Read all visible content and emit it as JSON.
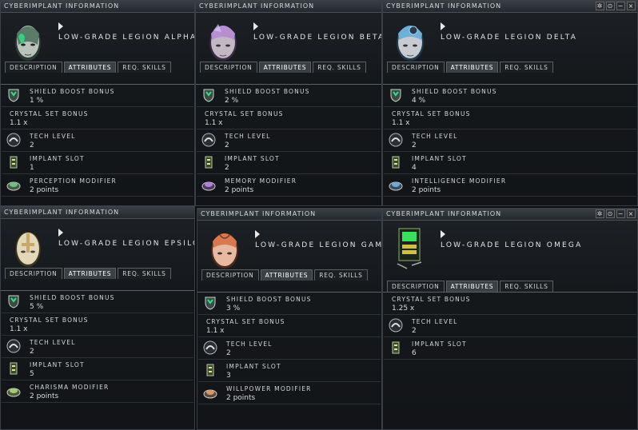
{
  "windows": [
    {
      "title": "CYBERIMPLANT INFORMATION",
      "name": "LOW-GRADE LEGION ALPHA",
      "tabs": [
        "DESCRIPTION",
        "ATTRIBUTES",
        "REQ. SKILLS"
      ],
      "rows": [
        {
          "label": "SHIELD BOOST BONUS",
          "value": "1 %"
        },
        {
          "label": "CRYSTAL SET BONUS",
          "value": "1.1 x"
        },
        {
          "label": "TECH LEVEL",
          "value": "2"
        },
        {
          "label": "IMPLANT SLOT",
          "value": "1"
        },
        {
          "label": "PERCEPTION MODIFIER",
          "value": "2 points"
        }
      ]
    },
    {
      "title": "CYBERIMPLANT INFORMATION",
      "name": "LOW-GRADE LEGION BETA",
      "tabs": [
        "DESCRIPTION",
        "ATTRIBUTES",
        "REQ. SKILLS"
      ],
      "rows": [
        {
          "label": "SHIELD BOOST BONUS",
          "value": "2 %"
        },
        {
          "label": "CRYSTAL SET BONUS",
          "value": "1.1 x"
        },
        {
          "label": "TECH LEVEL",
          "value": "2"
        },
        {
          "label": "IMPLANT SLOT",
          "value": "2"
        },
        {
          "label": "MEMORY MODIFIER",
          "value": "2 points"
        }
      ]
    },
    {
      "title": "CYBERIMPLANT INFORMATION",
      "name": "LOW-GRADE LEGION DELTA",
      "tabs": [
        "DESCRIPTION",
        "ATTRIBUTES",
        "REQ. SKILLS"
      ],
      "buttons": [
        "✲",
        "⊙",
        "−",
        "×"
      ],
      "rows": [
        {
          "label": "SHIELD BOOST BONUS",
          "value": "4 %"
        },
        {
          "label": "CRYSTAL SET BONUS",
          "value": "1.1 x"
        },
        {
          "label": "TECH LEVEL",
          "value": "2"
        },
        {
          "label": "IMPLANT SLOT",
          "value": "4"
        },
        {
          "label": "INTELLIGENCE MODIFIER",
          "value": "2 points"
        }
      ]
    },
    {
      "title": "CYBERIMPLANT INFORMATION",
      "name": "LOW-GRADE LEGION EPSILO",
      "tabs": [
        "DESCRIPTION",
        "ATTRIBUTES",
        "REQ. SKILLS"
      ],
      "rows": [
        {
          "label": "SHIELD BOOST BONUS",
          "value": "5 %"
        },
        {
          "label": "CRYSTAL SET BONUS",
          "value": "1.1 x"
        },
        {
          "label": "TECH LEVEL",
          "value": "2"
        },
        {
          "label": "IMPLANT SLOT",
          "value": "5"
        },
        {
          "label": "CHARISMA MODIFIER",
          "value": "2 points"
        }
      ]
    },
    {
      "title": "CYBERIMPLANT INFORMATION",
      "name": "LOW-GRADE LEGION GAMM",
      "tabs": [
        "DESCRIPTION",
        "ATTRIBUTES",
        "REQ. SKILLS"
      ],
      "rows": [
        {
          "label": "SHIELD BOOST BONUS",
          "value": "3 %"
        },
        {
          "label": "CRYSTAL SET BONUS",
          "value": "1.1 x"
        },
        {
          "label": "TECH LEVEL",
          "value": "2"
        },
        {
          "label": "IMPLANT SLOT",
          "value": "3"
        },
        {
          "label": "WILLPOWER MODIFIER",
          "value": "2 points"
        }
      ]
    },
    {
      "title": "CYBERIMPLANT INFORMATION",
      "name": "LOW-GRADE LEGION OMEGA",
      "tabs": [
        "DESCRIPTION",
        "ATTRIBUTES",
        "REQ. SKILLS"
      ],
      "buttons": [
        "✲",
        "⊙",
        "−",
        "×"
      ],
      "rows": [
        {
          "label": "CRYSTAL SET BONUS",
          "value": "1.25 x"
        },
        {
          "label": "TECH LEVEL",
          "value": "2"
        },
        {
          "label": "IMPLANT SLOT",
          "value": "6"
        }
      ]
    }
  ]
}
